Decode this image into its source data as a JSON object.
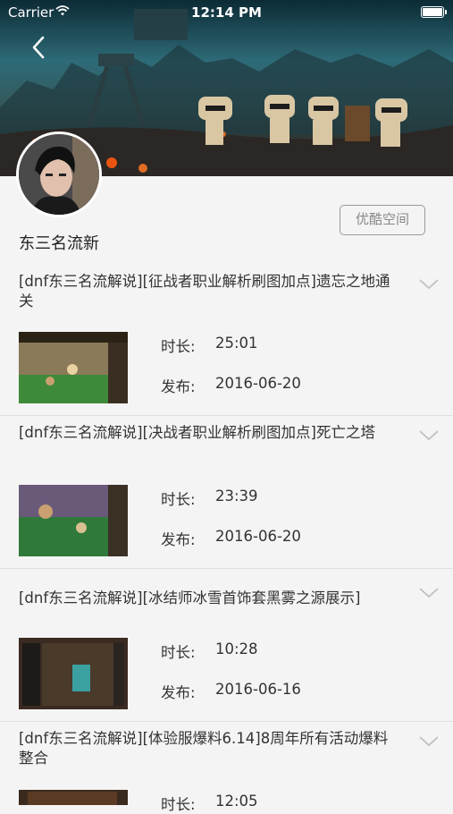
{
  "status_bar": {
    "carrier": "Carrier",
    "time": "12:14 PM"
  },
  "header": {
    "back_icon": "chevron-left-icon",
    "banner_description_colors": [
      "#0d2a33",
      "#2b5c66",
      "#1a1d1d"
    ]
  },
  "profile": {
    "channel_name": "东三名流新",
    "youku_space_label": "优酷空间"
  },
  "labels": {
    "duration": "时长:",
    "published": "发布:"
  },
  "videos": [
    {
      "title": "[dnf东三名流解说][征战者职业解析刷图加点]遗忘之地通关",
      "duration": "25:01",
      "published": "2016-06-20"
    },
    {
      "title": "[dnf东三名流解说][决战者职业解析刷图加点]死亡之塔",
      "duration": "23:39",
      "published": "2016-06-20"
    },
    {
      "title": "[dnf东三名流解说][冰结师冰雪首饰套黑雾之源展示]",
      "duration": "10:28",
      "published": "2016-06-16"
    },
    {
      "title": "[dnf东三名流解说][体验服爆料6.14]8周年所有活动爆料整合",
      "duration": "12:05",
      "published": ""
    }
  ]
}
